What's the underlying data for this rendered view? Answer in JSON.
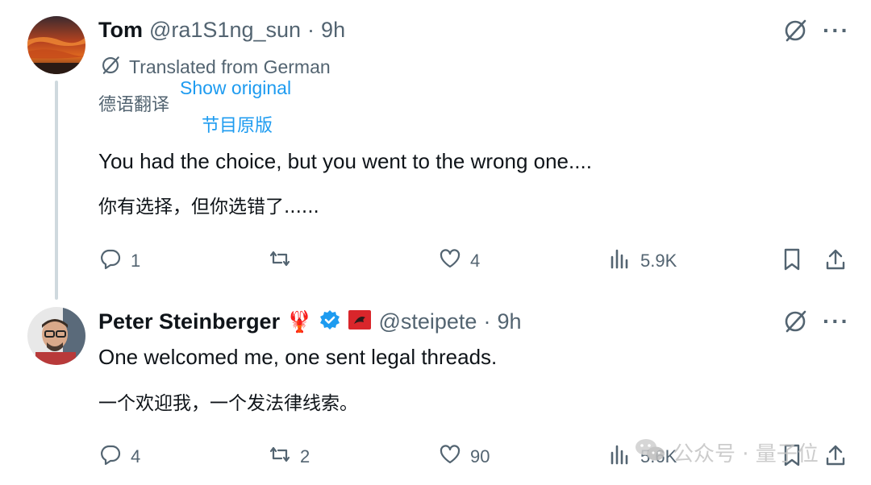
{
  "tweet1": {
    "author_name": "Tom",
    "handle": "@ra1S1ng_sun",
    "separator": "·",
    "time": "9h",
    "translated_note": "Translated from German",
    "annotation_translated": "德语翻译",
    "show_original": "Show original",
    "annotation_original": "节目原版",
    "text": "You had the choice, but you went to the wrong one....",
    "text_zh": "你有选择，但你选错了......",
    "stats": {
      "replies": "1",
      "reposts": "",
      "likes": "4",
      "views": "5.9K"
    }
  },
  "tweet2": {
    "author_name": "Peter Steinberger",
    "lobster_emoji": "🦞",
    "handle": "@steipete",
    "separator": "·",
    "time": "9h",
    "text": "One welcomed me, one sent legal threads.",
    "text_zh": "一个欢迎我，一个发法律线索。",
    "stats": {
      "replies": "4",
      "reposts": "2",
      "likes": "90",
      "views": "5.6K"
    }
  },
  "more_glyph": "···",
  "watermark": {
    "text": "公众号 · 量子位"
  },
  "colors": {
    "accent": "#1d9bf0",
    "muted": "#536471",
    "text": "#0f1419",
    "thread_line": "#cfd9de"
  },
  "icons": [
    "translate-icon",
    "more-icon",
    "reply-icon",
    "repost-icon",
    "like-icon",
    "views-icon",
    "bookmark-icon",
    "share-icon",
    "verified-icon",
    "flag-icon",
    "wechat-icon"
  ]
}
